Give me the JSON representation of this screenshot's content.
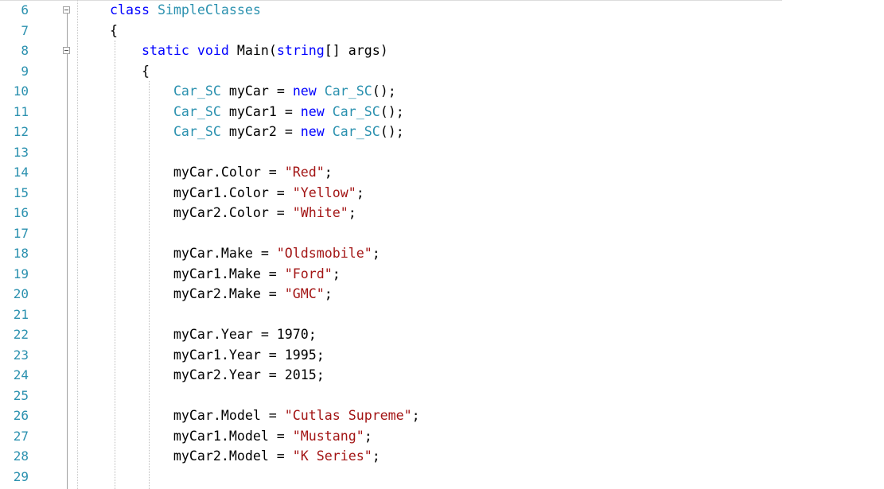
{
  "editor": {
    "lines": [
      {
        "number": "6",
        "fold": "minus",
        "tokens": [
          {
            "t": "keyword",
            "v": "class"
          },
          {
            "t": "plain",
            "v": " "
          },
          {
            "t": "type",
            "v": "SimpleClasses"
          }
        ]
      },
      {
        "number": "7",
        "tokens": [
          {
            "t": "plain",
            "v": "{"
          }
        ]
      },
      {
        "number": "8",
        "fold": "minus",
        "tokens": [
          {
            "t": "plain",
            "v": "    "
          },
          {
            "t": "keyword",
            "v": "static"
          },
          {
            "t": "plain",
            "v": " "
          },
          {
            "t": "keyword",
            "v": "void"
          },
          {
            "t": "plain",
            "v": " Main("
          },
          {
            "t": "keyword",
            "v": "string"
          },
          {
            "t": "plain",
            "v": "[] args)"
          }
        ]
      },
      {
        "number": "9",
        "tokens": [
          {
            "t": "plain",
            "v": "    {"
          }
        ]
      },
      {
        "number": "10",
        "tokens": [
          {
            "t": "plain",
            "v": "        "
          },
          {
            "t": "type",
            "v": "Car_SC"
          },
          {
            "t": "plain",
            "v": " myCar = "
          },
          {
            "t": "keyword",
            "v": "new"
          },
          {
            "t": "plain",
            "v": " "
          },
          {
            "t": "type",
            "v": "Car_SC"
          },
          {
            "t": "plain",
            "v": "();"
          }
        ]
      },
      {
        "number": "11",
        "tokens": [
          {
            "t": "plain",
            "v": "        "
          },
          {
            "t": "type",
            "v": "Car_SC"
          },
          {
            "t": "plain",
            "v": " myCar1 = "
          },
          {
            "t": "keyword",
            "v": "new"
          },
          {
            "t": "plain",
            "v": " "
          },
          {
            "t": "type",
            "v": "Car_SC"
          },
          {
            "t": "plain",
            "v": "();"
          }
        ]
      },
      {
        "number": "12",
        "tokens": [
          {
            "t": "plain",
            "v": "        "
          },
          {
            "t": "type",
            "v": "Car_SC"
          },
          {
            "t": "plain",
            "v": " myCar2 = "
          },
          {
            "t": "keyword",
            "v": "new"
          },
          {
            "t": "plain",
            "v": " "
          },
          {
            "t": "type",
            "v": "Car_SC"
          },
          {
            "t": "plain",
            "v": "();"
          }
        ]
      },
      {
        "number": "13",
        "tokens": []
      },
      {
        "number": "14",
        "tokens": [
          {
            "t": "plain",
            "v": "        myCar.Color = "
          },
          {
            "t": "string",
            "v": "\"Red\""
          },
          {
            "t": "plain",
            "v": ";"
          }
        ]
      },
      {
        "number": "15",
        "tokens": [
          {
            "t": "plain",
            "v": "        myCar1.Color = "
          },
          {
            "t": "string",
            "v": "\"Yellow\""
          },
          {
            "t": "plain",
            "v": ";"
          }
        ]
      },
      {
        "number": "16",
        "tokens": [
          {
            "t": "plain",
            "v": "        myCar2.Color = "
          },
          {
            "t": "string",
            "v": "\"White\""
          },
          {
            "t": "plain",
            "v": ";"
          }
        ]
      },
      {
        "number": "17",
        "tokens": []
      },
      {
        "number": "18",
        "tokens": [
          {
            "t": "plain",
            "v": "        myCar.Make = "
          },
          {
            "t": "string",
            "v": "\"Oldsmobile\""
          },
          {
            "t": "plain",
            "v": ";"
          }
        ]
      },
      {
        "number": "19",
        "tokens": [
          {
            "t": "plain",
            "v": "        myCar1.Make = "
          },
          {
            "t": "string",
            "v": "\"Ford\""
          },
          {
            "t": "plain",
            "v": ";"
          }
        ]
      },
      {
        "number": "20",
        "tokens": [
          {
            "t": "plain",
            "v": "        myCar2.Make = "
          },
          {
            "t": "string",
            "v": "\"GMC\""
          },
          {
            "t": "plain",
            "v": ";"
          }
        ]
      },
      {
        "number": "21",
        "tokens": []
      },
      {
        "number": "22",
        "tokens": [
          {
            "t": "plain",
            "v": "        myCar.Year = 1970;"
          }
        ]
      },
      {
        "number": "23",
        "tokens": [
          {
            "t": "plain",
            "v": "        myCar1.Year = 1995;"
          }
        ]
      },
      {
        "number": "24",
        "tokens": [
          {
            "t": "plain",
            "v": "        myCar2.Year = 2015;"
          }
        ]
      },
      {
        "number": "25",
        "tokens": []
      },
      {
        "number": "26",
        "tokens": [
          {
            "t": "plain",
            "v": "        myCar.Model = "
          },
          {
            "t": "string",
            "v": "\"Cutlas Supreme\""
          },
          {
            "t": "plain",
            "v": ";"
          }
        ]
      },
      {
        "number": "27",
        "tokens": [
          {
            "t": "plain",
            "v": "        myCar1.Model = "
          },
          {
            "t": "string",
            "v": "\"Mustang\""
          },
          {
            "t": "plain",
            "v": ";"
          }
        ]
      },
      {
        "number": "28",
        "tokens": [
          {
            "t": "plain",
            "v": "        myCar2.Model = "
          },
          {
            "t": "string",
            "v": "\"K Series\""
          },
          {
            "t": "plain",
            "v": ";"
          }
        ]
      },
      {
        "number": "29",
        "tokens": []
      }
    ]
  },
  "colors": {
    "keyword": "#0000ff",
    "type": "#2b91af",
    "string": "#a31515",
    "line_number": "#2b91af",
    "plain": "#000000"
  }
}
